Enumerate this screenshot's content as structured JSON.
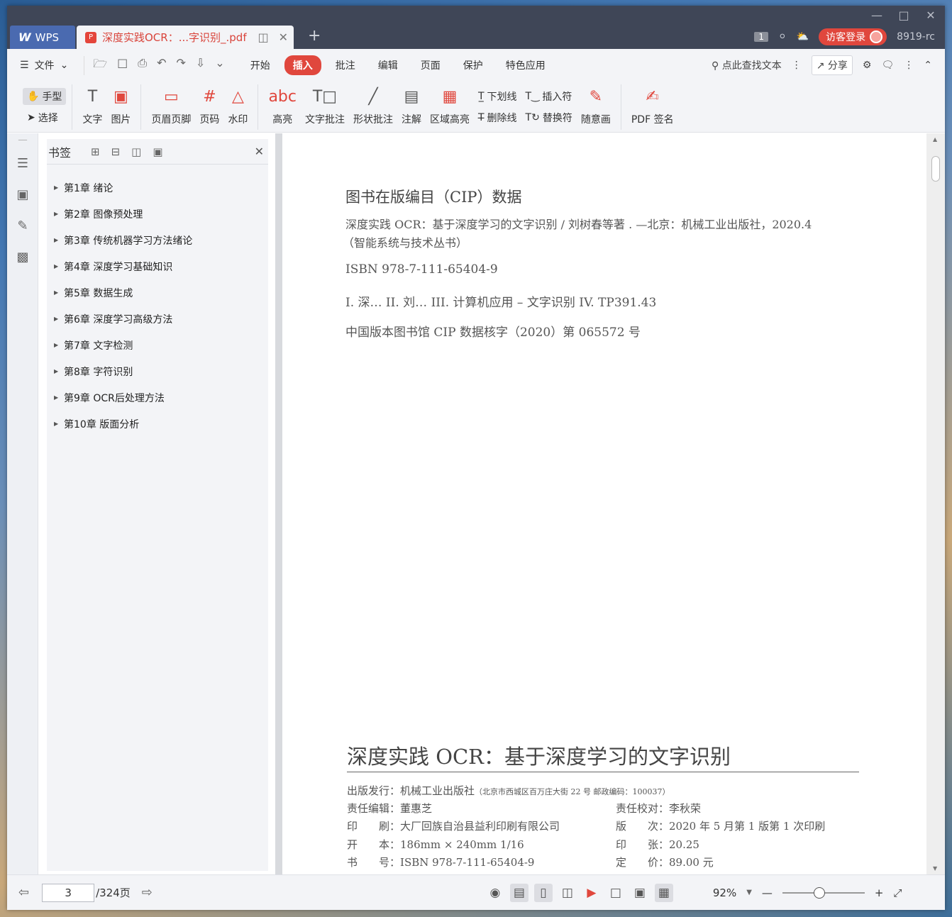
{
  "titlebar": {
    "app_tab": "WPS",
    "doc_tab": "深度实践OCR：...字识别_.pdf",
    "badge": "1",
    "login": "访客登录",
    "user": "8919-rc"
  },
  "menu": {
    "file": "文件",
    "tabs": [
      "开始",
      "插入",
      "批注",
      "编辑",
      "页面",
      "保护",
      "特色应用"
    ],
    "active_tab": "插入",
    "search": "点此查找文本",
    "share": "分享"
  },
  "ribbon": {
    "hand": "手型",
    "select": "选择",
    "text": "文字",
    "image": "图片",
    "header_footer": "页眉页脚",
    "page_num": "页码",
    "watermark": "水印",
    "highlight": "高亮",
    "text_comment": "文字批注",
    "shape_comment": "形状批注",
    "note": "注解",
    "area_highlight": "区域高亮",
    "underline": "下划线",
    "strikethrough": "删除线",
    "insert_mark": "插入符",
    "replace_mark": "替换符",
    "freehand": "随意画",
    "pdf_sign": "PDF 签名"
  },
  "panel": {
    "title": "书签",
    "items": [
      "第1章 绪论",
      "第2章 图像预处理",
      "第3章 传统机器学习方法绪论",
      "第4章 深度学习基础知识",
      "第5章 数据生成",
      "第6章 深度学习高级方法",
      "第7章 文字检测",
      "第8章 字符识别",
      "第9章 OCR后处理方法",
      "第10章 版面分析"
    ]
  },
  "page": {
    "cip_title": "图书在版编目（CIP）数据",
    "cip_line1": "深度实践 OCR：基于深度学习的文字识别 / 刘树春等著 . —北京：机械工业出版社，2020.4",
    "cip_line2": "（智能系统与技术丛书）",
    "isbn": "ISBN 978-7-111-65404-9",
    "classification": "I. 深…   II. 刘…   III. 计算机应用 – 文字识别   IV. TP391.43",
    "library": "中国版本图书馆 CIP 数据核字（2020）第 065572 号",
    "book_title": "深度实践 OCR：基于深度学习的文字识别",
    "publisher_label": "出版发行：",
    "publisher": "机械工业出版社",
    "publisher_addr": "（北京市西城区百万庄大街 22 号   邮政编码：100037）",
    "editor_label": "责任编辑：",
    "editor": "董惠芝",
    "proof_label": "责任校对：",
    "proof": "李秋荣",
    "print_label": "印　　刷：",
    "printer": "大厂回族自治县益利印刷有限公司",
    "edition_label": "版　　次：",
    "edition": "2020 年 5 月第 1 版第 1 次印刷",
    "format_label": "开　　本：",
    "format": "186mm × 240mm   1/16",
    "sheets_label": "印　　张：",
    "sheets": "20.25",
    "book_no_label": "书　　号：",
    "book_no": "ISBN 978-7-111-65404-9",
    "price_label": "定　　价：",
    "price": "89.00 元"
  },
  "status": {
    "current_page": "3",
    "total": "/324页",
    "zoom": "92%"
  }
}
